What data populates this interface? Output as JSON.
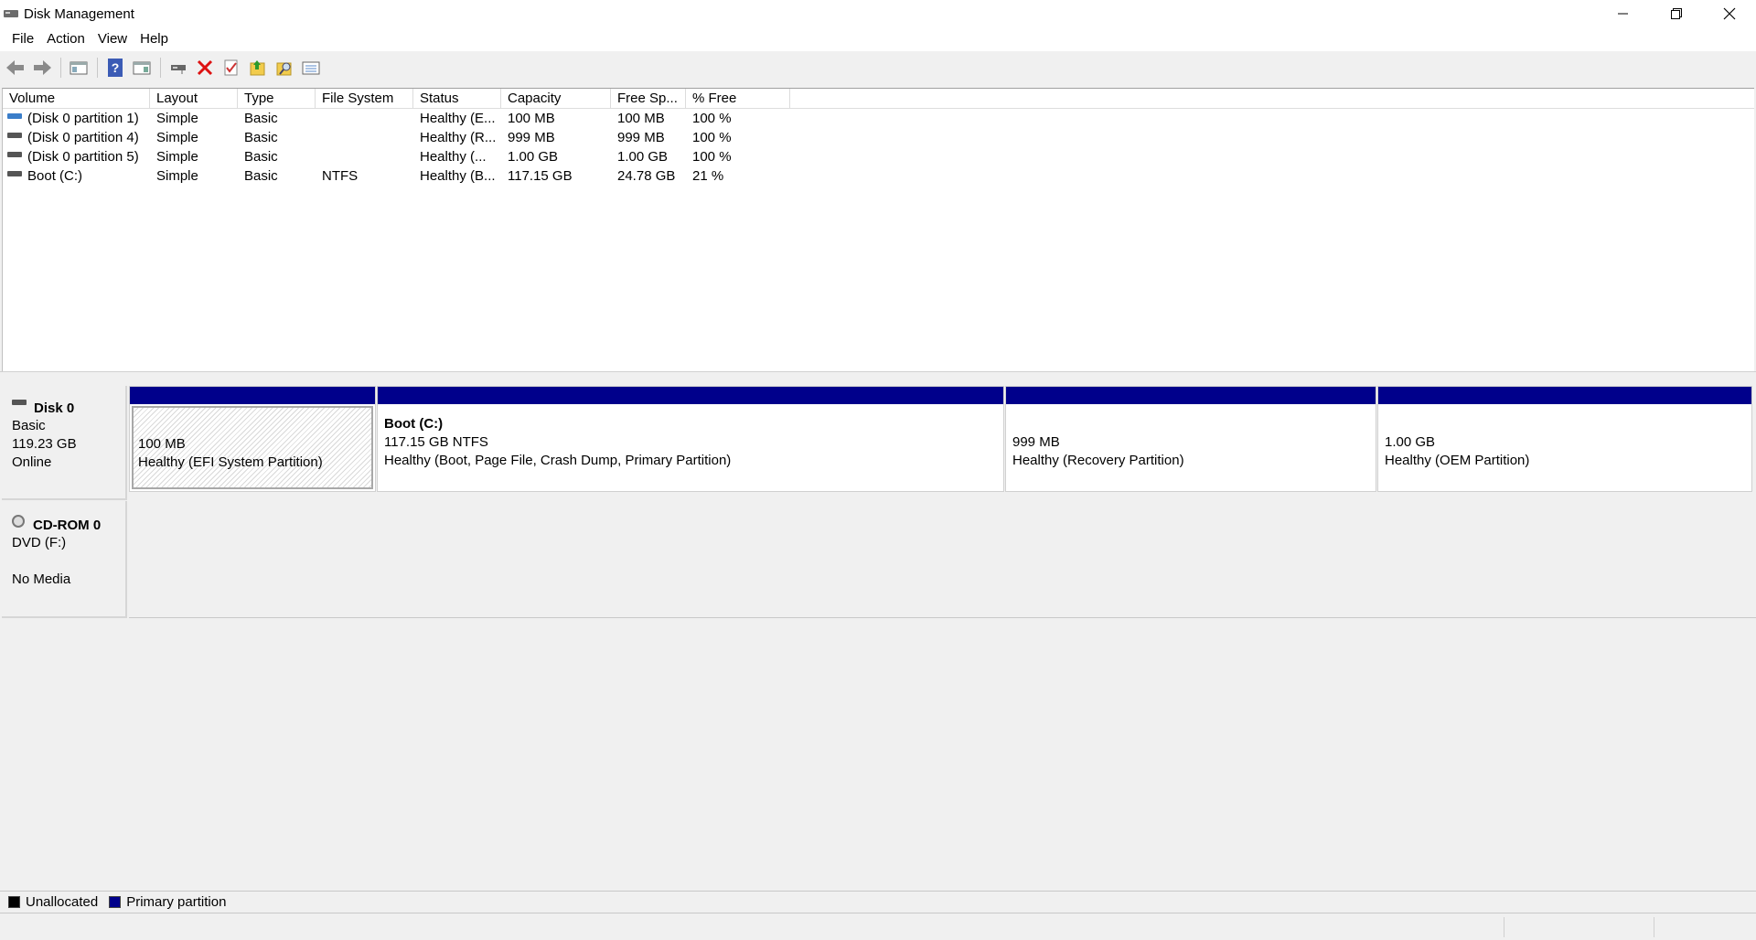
{
  "window": {
    "title": "Disk Management",
    "minimize_icon": "minimize-icon",
    "restore_icon": "restore-icon",
    "close_icon": "close-icon"
  },
  "menu": [
    "File",
    "Action",
    "View",
    "Help"
  ],
  "toolbar": {
    "icons": [
      "back-arrow-icon",
      "forward-arrow-icon",
      "console-tree-icon",
      "help-icon",
      "show-hide-pane-icon",
      "connect-disk-icon",
      "delete-icon",
      "properties-check-icon",
      "open-folder-icon",
      "explore-icon",
      "list-view-icon"
    ]
  },
  "volume_list": {
    "columns": [
      "Volume",
      "Layout",
      "Type",
      "File System",
      "Status",
      "Capacity",
      "Free Sp...",
      "% Free"
    ],
    "rows": [
      {
        "volume": "(Disk 0 partition 1)",
        "layout": "Simple",
        "type": "Basic",
        "fs": "",
        "status": "Healthy (E...",
        "capacity": "100 MB",
        "free": "100 MB",
        "pct": "100 %",
        "icon_color": "blue"
      },
      {
        "volume": "(Disk 0 partition 4)",
        "layout": "Simple",
        "type": "Basic",
        "fs": "",
        "status": "Healthy (R...",
        "capacity": "999 MB",
        "free": "999 MB",
        "pct": "100 %",
        "icon_color": "gray"
      },
      {
        "volume": "(Disk 0 partition 5)",
        "layout": "Simple",
        "type": "Basic",
        "fs": "",
        "status": "Healthy (...",
        "capacity": "1.00 GB",
        "free": "1.00 GB",
        "pct": "100 %",
        "icon_color": "gray"
      },
      {
        "volume": "Boot (C:)",
        "layout": "Simple",
        "type": "Basic",
        "fs": "NTFS",
        "status": "Healthy (B...",
        "capacity": "117.15 GB",
        "free": "24.78 GB",
        "pct": "21 %",
        "icon_color": "gray"
      }
    ]
  },
  "disks": [
    {
      "name": "Disk 0",
      "type": "Basic",
      "size": "119.23 GB",
      "state": "Online",
      "partitions": [
        {
          "name": "",
          "size": "100 MB",
          "status": "Healthy (EFI System Partition)",
          "selected": true
        },
        {
          "name": "Boot  (C:)",
          "size": "117.15 GB NTFS",
          "status": "Healthy (Boot, Page File, Crash Dump, Primary Partition)",
          "selected": false
        },
        {
          "name": "",
          "size": "999 MB",
          "status": "Healthy (Recovery Partition)",
          "selected": false
        },
        {
          "name": "",
          "size": "1.00 GB",
          "status": "Healthy (OEM Partition)",
          "selected": false
        }
      ]
    }
  ],
  "cdrom": {
    "name": "CD-ROM 0",
    "drive": "DVD (F:)",
    "media": "No Media"
  },
  "legend": [
    {
      "label": "Unallocated",
      "color": "#000000"
    },
    {
      "label": "Primary partition",
      "color": "#00008b"
    }
  ]
}
